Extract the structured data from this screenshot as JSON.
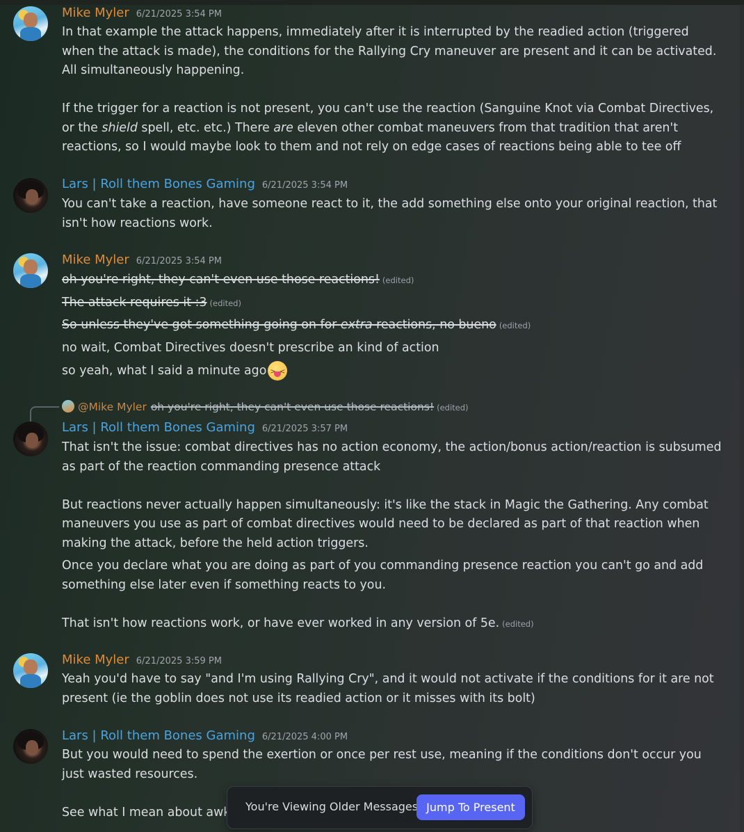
{
  "users": {
    "mike": {
      "name": "Mike Myler"
    },
    "lars": {
      "name": "Lars | Roll them Bones Gaming"
    }
  },
  "messages": [
    {
      "author": "Mike Myler",
      "timestamp": "6/21/2025 3:54 PM",
      "p1": "In that example the attack happens, immediately after it is interrupted by the readied action (triggered when the attack is made), the conditions for the Rallying Cry maneuver are present and it can be activated. All simultaneously happening.",
      "p2_a": "If the trigger for a reaction is not present, you can't use the reaction (Sanguine Knot via Combat Directives, or the ",
      "p2_em1": "shield",
      "p2_b": " spell, etc. etc.) There ",
      "p2_em2": "are",
      "p2_c": " eleven other combat maneuvers from that tradition that aren't reactions, so I would maybe look to them and not rely on edge cases of reactions being able to tee off"
    },
    {
      "author": "Lars | Roll them Bones Gaming",
      "timestamp": "6/21/2025 3:54 PM",
      "p1": "You can't take a reaction, have someone react to it, the add something else onto your original reaction, that isn't how reactions work."
    },
    {
      "author": "Mike Myler",
      "timestamp": "6/21/2025 3:54 PM",
      "l1": "oh you're right, they can't even use those reactions!",
      "l2": "The attack requires it :3",
      "l3_a": "So unless they've got something going on for ",
      "l3_em": "extra",
      "l3_b": " reactions, no bueno",
      "l4": "no wait, Combat Directives doesn't prescribe an kind of action",
      "l5": "so yeah, what I said a minute ago",
      "emoji": "squinting-face-with-tongue"
    },
    {
      "author": "Lars | Roll them Bones Gaming",
      "timestamp": "6/21/2025 3:57 PM",
      "reply_to": "@Mike Myler",
      "reply_text": "oh you're right, they can't even use those reactions!",
      "p1": "That isn't the issue: combat directives has no action economy, the action/bonus action/reaction is subsumed as part of the reaction commanding presence attack",
      "p2": "But reactions never actually happen simultaneously: it's like the stack in Magic the Gathering. Any combat maneuvers you use as part of combat directives would need to be declared as part of that reaction when making the attack, before the held action triggers.",
      "p3": "Once you declare what you are doing as part of you commanding presence reaction you can't go and add something else later even if something reacts to you.",
      "p4": "That isn't how reactions work, or have ever worked in any version of 5e."
    },
    {
      "author": "Mike Myler",
      "timestamp": "6/21/2025 3:59 PM",
      "p1": "Yeah you'd have to say \"and I'm using Rallying Cry\", and it would not activate if the conditions for it are not present (ie the goblin does not use its readied action or it misses with its bolt)"
    },
    {
      "author": "Lars | Roll them Bones Gaming",
      "timestamp": "6/21/2025 4:00 PM",
      "p1": "But you would need to spend the exertion or once per rest use, meaning if the conditions don't occur you just wasted resources.",
      "p2": "See what I mean about awkw"
    }
  ],
  "edited_label": "(edited)",
  "jump": {
    "text": "You're Viewing Older Messages",
    "button": "Jump To Present"
  },
  "colors": {
    "mike_name": "#e08b3a",
    "lars_name": "#4ba3df",
    "jump_button": "#5865f2"
  }
}
